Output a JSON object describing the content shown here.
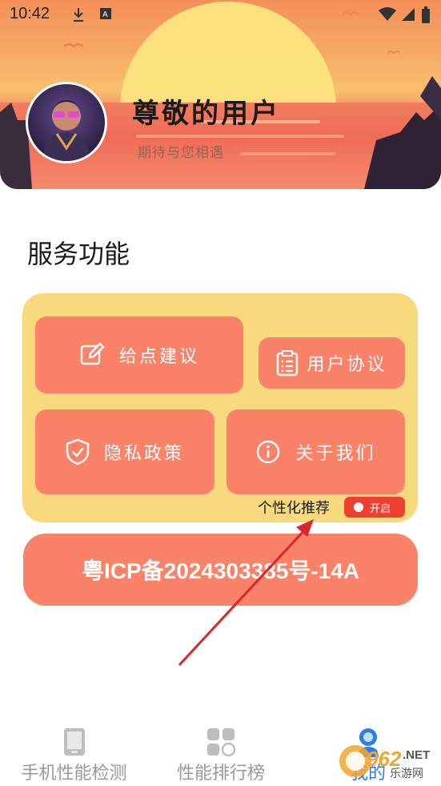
{
  "status_bar": {
    "time": "10:42",
    "icons": [
      "download-icon",
      "a-icon",
      "wifi-icon",
      "signal-icon",
      "battery-icon"
    ]
  },
  "profile": {
    "name": "尊敬的用户",
    "tagline": "期待与您相遇"
  },
  "services": {
    "title": "服务功能",
    "items": [
      {
        "label": "给点建议",
        "icon": "edit-icon"
      },
      {
        "label": "用户协议",
        "icon": "clipboard-icon"
      },
      {
        "label": "隐私政策",
        "icon": "shield-check-icon"
      },
      {
        "label": "关于我们",
        "icon": "info-icon"
      }
    ],
    "personalized": {
      "label": "个性化推荐",
      "toggle_label": "开启",
      "enabled": true
    }
  },
  "icp": {
    "text": "粤ICP备2024303385号-14A"
  },
  "bottom_nav": {
    "items": [
      {
        "label": "手机性能检测",
        "icon": "phone-icon"
      },
      {
        "label": "性能排行榜",
        "icon": "grid-icon"
      },
      {
        "label": "我的",
        "icon": "person-icon"
      }
    ]
  },
  "watermark": {
    "brand": "962",
    "suffix": ".NET",
    "cn": "乐游网"
  },
  "colors": {
    "accent": "#f98268",
    "card_bg": "#f9d97e",
    "toggle": "#f03e31",
    "nav_active": "#2f7ce8"
  }
}
